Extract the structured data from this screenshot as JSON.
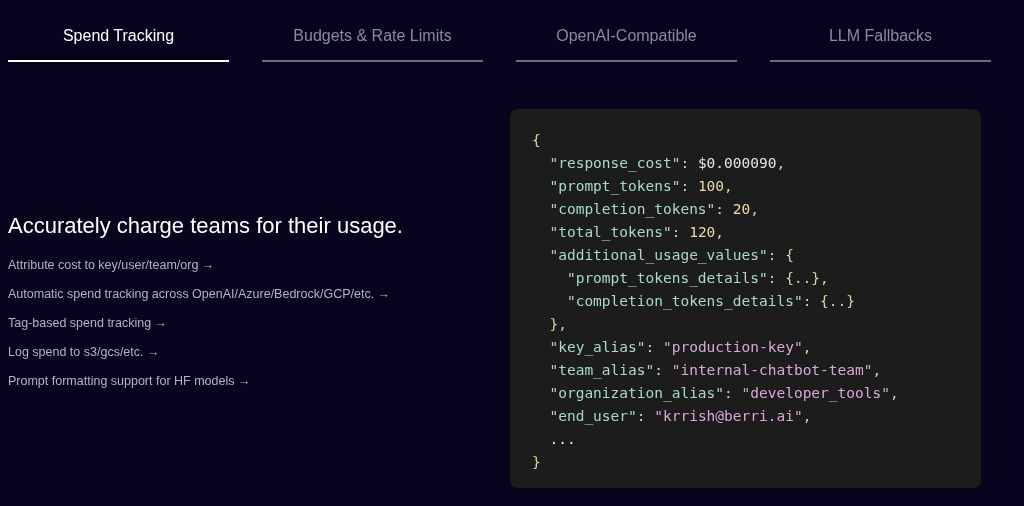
{
  "tabs": [
    {
      "label": "Spend Tracking",
      "selected": true
    },
    {
      "label": "Budgets & Rate Limits",
      "selected": false
    },
    {
      "label": "OpenAI-Compatible",
      "selected": false
    },
    {
      "label": "LLM Fallbacks",
      "selected": false
    }
  ],
  "heading": "Accurately charge teams for their usage.",
  "links": [
    "Attribute cost to key/user/team/org →",
    "Automatic spend tracking across OpenAI/Azure/Bedrock/GCP/etc. →",
    "Tag-based spend tracking →",
    "Log spend to s3/gcs/etc. →",
    "Prompt formatting support for HF models →"
  ],
  "code_lines": [
    [
      {
        "kind": "punct",
        "text": "{"
      }
    ],
    [
      {
        "kind": "key",
        "text": "  \"response_cost\""
      },
      {
        "kind": "punct",
        "text": ": "
      },
      {
        "kind": "plain",
        "text": "$0.000090"
      },
      {
        "kind": "punct",
        "text": ","
      }
    ],
    [
      {
        "kind": "key",
        "text": "  \"prompt_tokens\""
      },
      {
        "kind": "punct",
        "text": ": "
      },
      {
        "kind": "number",
        "text": "100"
      },
      {
        "kind": "punct",
        "text": ","
      }
    ],
    [
      {
        "kind": "key",
        "text": "  \"completion_tokens\""
      },
      {
        "kind": "punct",
        "text": ": "
      },
      {
        "kind": "number",
        "text": "20"
      },
      {
        "kind": "punct",
        "text": ","
      }
    ],
    [
      {
        "kind": "key",
        "text": "  \"total_tokens\""
      },
      {
        "kind": "punct",
        "text": ": "
      },
      {
        "kind": "number",
        "text": "120"
      },
      {
        "kind": "punct",
        "text": ","
      }
    ],
    [
      {
        "kind": "key",
        "text": "  \"additional_usage_values\""
      },
      {
        "kind": "punct",
        "text": ": {"
      }
    ],
    [
      {
        "kind": "key",
        "text": "    \"prompt_tokens_details\""
      },
      {
        "kind": "punct",
        "text": ": {..},"
      }
    ],
    [
      {
        "kind": "key",
        "text": "    \"completion_tokens_details\""
      },
      {
        "kind": "punct",
        "text": ": {..}"
      }
    ],
    [
      {
        "kind": "punct",
        "text": "  },"
      }
    ],
    [
      {
        "kind": "key",
        "text": "  \"key_alias\""
      },
      {
        "kind": "punct",
        "text": ": "
      },
      {
        "kind": "string",
        "text": "\"production-key\""
      },
      {
        "kind": "punct",
        "text": ","
      }
    ],
    [
      {
        "kind": "key",
        "text": "  \"team_alias\""
      },
      {
        "kind": "punct",
        "text": ": "
      },
      {
        "kind": "string",
        "text": "\"internal-chatbot-team\""
      },
      {
        "kind": "punct",
        "text": ","
      }
    ],
    [
      {
        "kind": "key",
        "text": "  \"organization_alias\""
      },
      {
        "kind": "punct",
        "text": ": "
      },
      {
        "kind": "string",
        "text": "\"developer_tools\""
      },
      {
        "kind": "punct",
        "text": ","
      }
    ],
    [
      {
        "kind": "key",
        "text": "  \"end_user\""
      },
      {
        "kind": "punct",
        "text": ": "
      },
      {
        "kind": "string",
        "text": "\"krrish@berri.ai\""
      },
      {
        "kind": "punct",
        "text": ","
      }
    ],
    [
      {
        "kind": "plain",
        "text": "  ..."
      }
    ],
    [
      {
        "kind": "punct",
        "text": "}"
      }
    ]
  ]
}
